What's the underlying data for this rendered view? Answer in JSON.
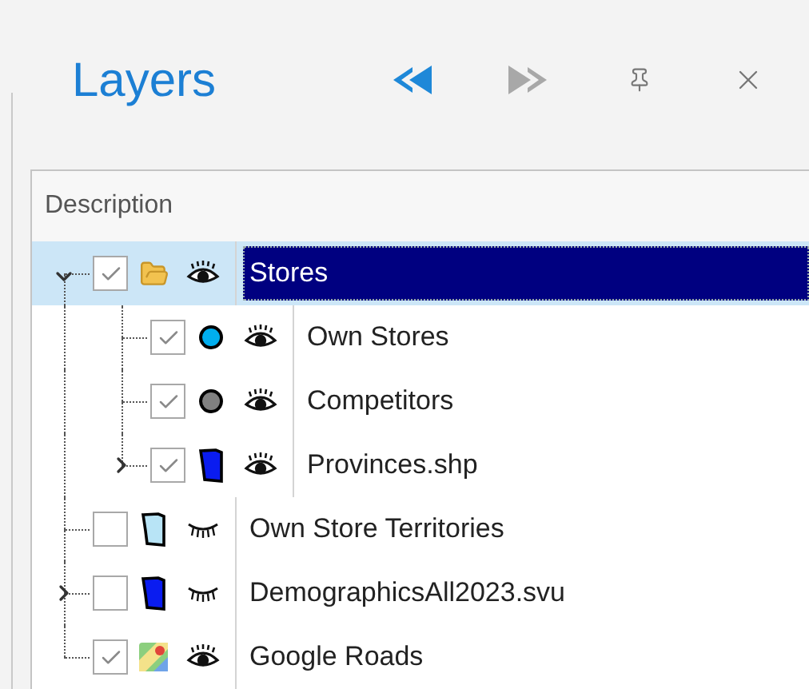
{
  "panel": {
    "title": "Layers"
  },
  "toolbar": [
    {
      "kind": "back",
      "disabled": false
    },
    {
      "kind": "forward",
      "disabled": true
    },
    {
      "kind": "pin",
      "disabled": false
    },
    {
      "kind": "close",
      "disabled": false
    }
  ],
  "table": {
    "column": "Description"
  },
  "layers": [
    {
      "label": "Stores",
      "checked": true,
      "visible": true,
      "kind": "folder",
      "selected": true,
      "expanded": true,
      "children": [
        {
          "label": "Own Stores",
          "checked": true,
          "visible": true,
          "kind": "point",
          "color": "#00aeef",
          "selected": false
        },
        {
          "label": "Competitors",
          "checked": true,
          "visible": true,
          "kind": "point",
          "color": "#808080",
          "selected": false
        },
        {
          "label": "Provinces.shp",
          "checked": true,
          "visible": true,
          "kind": "polygon",
          "color": "#0a1cf0",
          "selected": false,
          "expanded": false
        }
      ]
    },
    {
      "label": "Own Store Territories",
      "checked": false,
      "visible": false,
      "kind": "polygon",
      "color": "#b8e4f6",
      "selected": false
    },
    {
      "label": "DemographicsAll2023.svu",
      "checked": false,
      "visible": false,
      "kind": "polygon",
      "color": "#0a1cf0",
      "selected": false,
      "expanded": false
    },
    {
      "label": "Google Roads",
      "checked": true,
      "visible": true,
      "kind": "map",
      "selected": false
    }
  ]
}
